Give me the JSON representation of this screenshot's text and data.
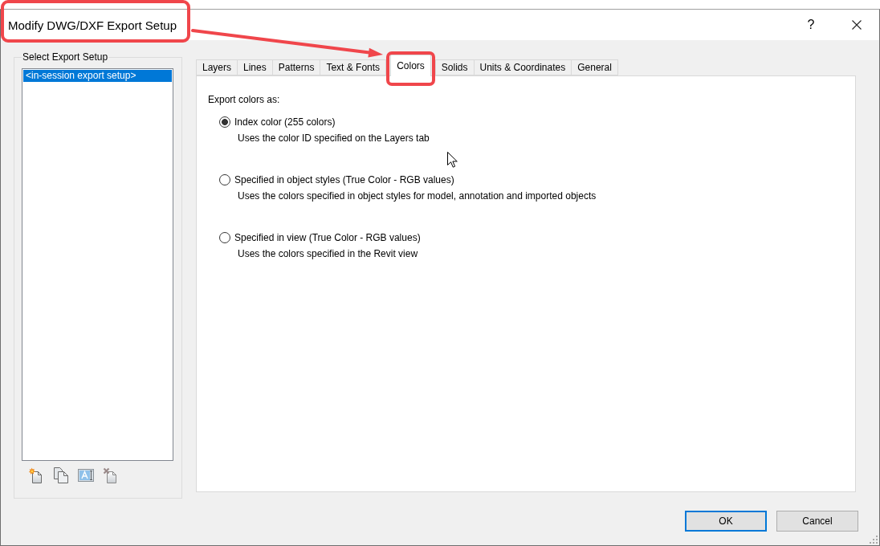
{
  "window": {
    "title": {
      "text": "Modify DWG/DXF Export Setup",
      "highlighted": true
    },
    "help_button": "?"
  },
  "callout_arrow": true,
  "setup_group": {
    "title": "Select Export Setup",
    "items": [
      {
        "label": "<in-session export setup>",
        "selected": true
      }
    ]
  },
  "tabs": [
    {
      "label": "Layers",
      "selected": false,
      "highlighted": false
    },
    {
      "label": "Lines",
      "selected": false,
      "highlighted": false
    },
    {
      "label": "Patterns",
      "selected": false,
      "highlighted": false
    },
    {
      "label": "Text & Fonts",
      "selected": false,
      "highlighted": false
    },
    {
      "label": "Colors",
      "selected": true,
      "highlighted": true
    },
    {
      "label": "Solids",
      "selected": false,
      "highlighted": false
    },
    {
      "label": "Units & Coordinates",
      "selected": false,
      "highlighted": false
    },
    {
      "label": "General",
      "selected": false,
      "highlighted": false
    }
  ],
  "colors_panel": {
    "heading": "Export colors as:",
    "options": [
      {
        "label": "Index color (255 colors)",
        "description": "Uses the color ID specified on the Layers tab",
        "selected": true
      },
      {
        "label": "Specified in object styles (True Color - RGB values)",
        "description": "Uses the colors specified in object styles for model, annotation and imported objects",
        "selected": false
      },
      {
        "label": "Specified in view (True Color - RGB values)",
        "description": "Uses the colors specified in the Revit view",
        "selected": false
      }
    ]
  },
  "buttons": [
    {
      "label": "OK",
      "default": true
    },
    {
      "label": "Cancel",
      "default": false
    }
  ]
}
